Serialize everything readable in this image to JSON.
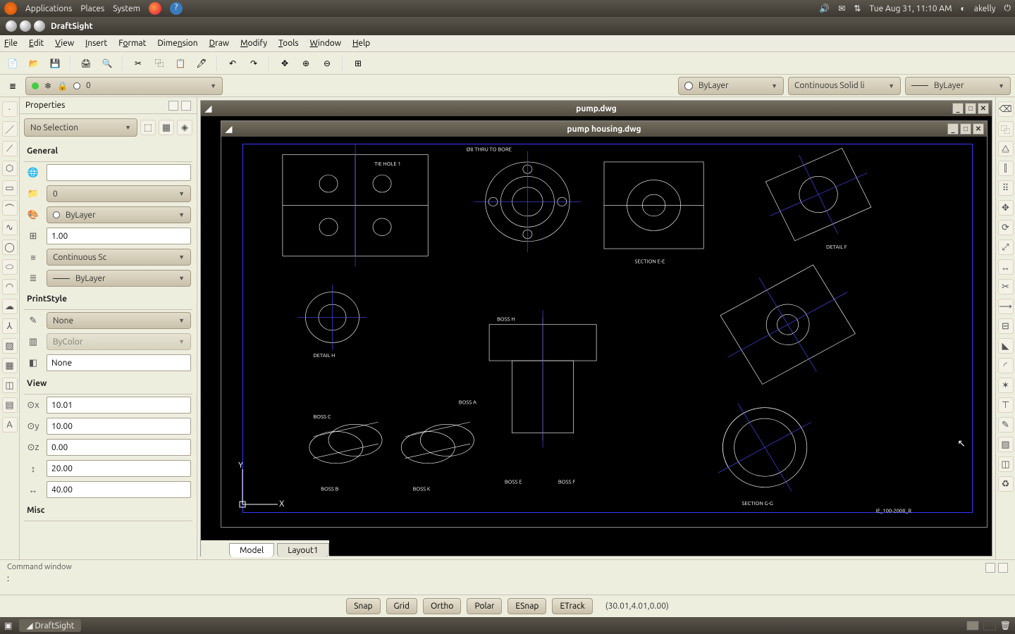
{
  "gnome": {
    "menus": [
      "Applications",
      "Places",
      "System"
    ],
    "clock": "Tue Aug 31, 11:10 AM",
    "user": "akelly"
  },
  "window": {
    "title": "DraftSight"
  },
  "menubar": [
    "File",
    "Edit",
    "View",
    "Insert",
    "Format",
    "Dimension",
    "Draw",
    "Modify",
    "Tools",
    "Window",
    "Help"
  ],
  "layer_combo": "0",
  "color_combo": "ByLayer",
  "linetype_combo": "Continuous      Solid li",
  "lineweight_combo": "ByLayer",
  "properties": {
    "title": "Properties",
    "selection": "No Selection",
    "general_h": "General",
    "hyperlink": "",
    "layer": "0",
    "color": "ByLayer",
    "scale": "1.00",
    "linetype": "Continuous    Sc",
    "lineweight": "ByLayer",
    "printstyle_h": "PrintStyle",
    "ps_style": "None",
    "ps_table": "ByColor",
    "ps_attached": "None",
    "view_h": "View",
    "vx": "10.01",
    "vy": "10.00",
    "vz": "0.00",
    "vw": "20.00",
    "vh": "40.00",
    "misc_h": "Misc"
  },
  "docs": {
    "outer": "pump.dwg",
    "inner": "pump housing.dwg"
  },
  "tabs": {
    "model": "Model",
    "layout": "Layout1"
  },
  "cmd": {
    "title": "Command window",
    "prompt": ":"
  },
  "status": {
    "snap": "Snap",
    "grid": "Grid",
    "ortho": "Ortho",
    "polar": "Polar",
    "esnap": "ESnap",
    "etrack": "ETrack",
    "coords": "(30.01,4.01,0.00)"
  },
  "taskbar": {
    "app": "DraftSight"
  },
  "drawing_labels": {
    "section_ee": "SECTION E-E",
    "section_gg": "SECTION G-G",
    "detail_h": "DETAIL H",
    "detail_f": "DETAIL F",
    "thru": "Ø8 THRU TO BORE",
    "tiehole": "TIE HOLE 1",
    "bossa": "BOSS A",
    "bossh": "BOSS H",
    "bossk": "BOSS K",
    "bossc": "BOSS C",
    "bossb": "BOSS B",
    "bossf": "BOSS F",
    "bosse": "BOSS E",
    "titleblock": "IE_100-2008_R"
  }
}
